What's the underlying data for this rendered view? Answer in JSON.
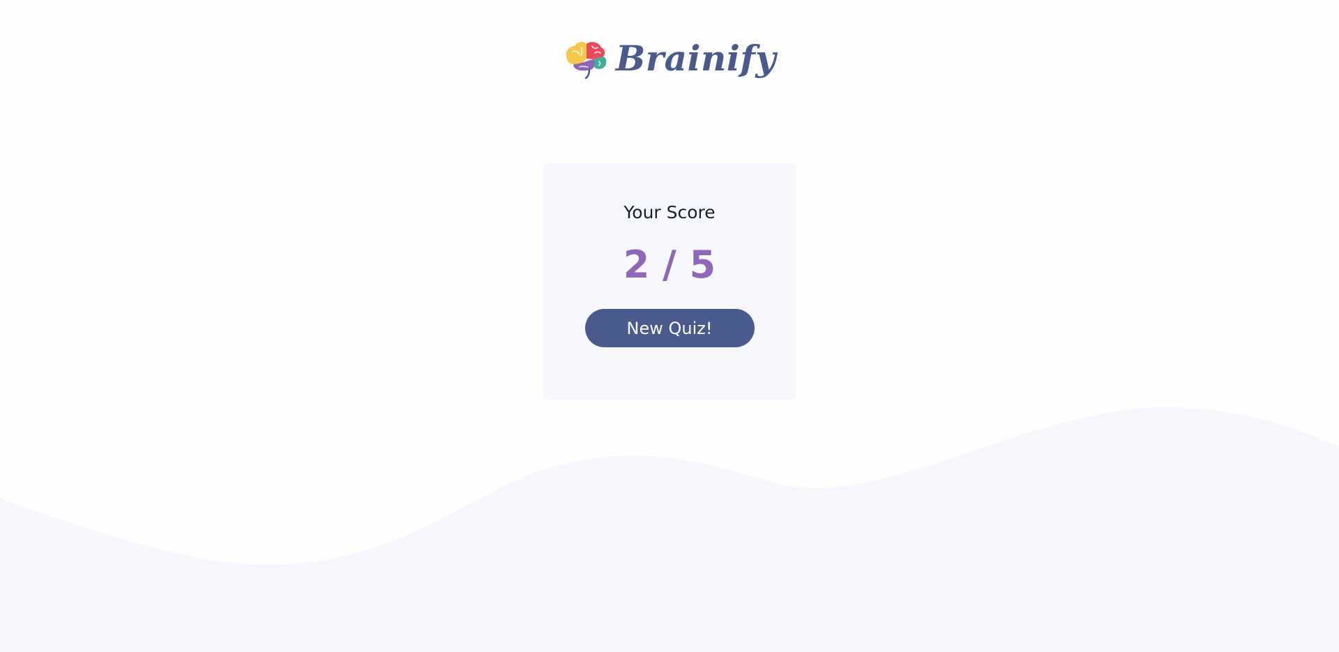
{
  "brand": {
    "name": "Brainify",
    "logo_icon": "colorful-brain-icon",
    "color": "#4a5a8c"
  },
  "score_card": {
    "label": "Your Score",
    "score": "2 / 5",
    "correct": 2,
    "total": 5,
    "score_color": "#9066b8"
  },
  "actions": {
    "new_quiz_label": "New Quiz!"
  },
  "colors": {
    "primary": "#4a5a8c",
    "accent": "#9066b8",
    "card_background": "#f7f8fd",
    "wave_background": "#f6f7fd",
    "brain_yellow": "#f6c94a",
    "brain_red": "#e84a5a",
    "brain_purple": "#8f64b8",
    "brain_teal": "#3fae9b"
  }
}
